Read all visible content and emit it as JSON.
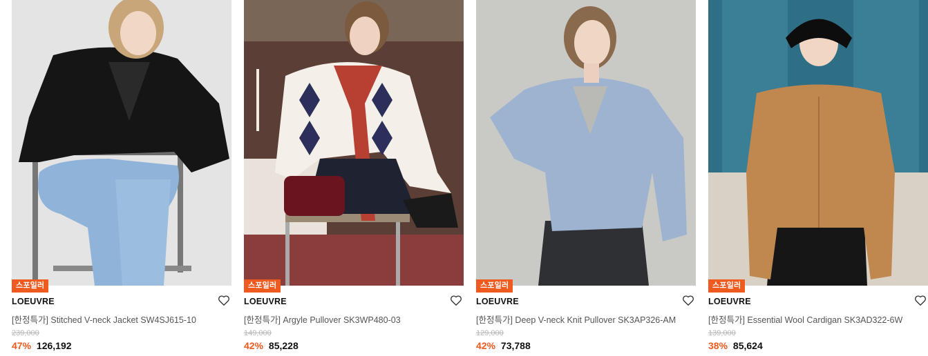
{
  "colors": {
    "accent": "#ef5a1f",
    "price": "#111111",
    "strike": "#b5b5b5"
  },
  "products": [
    {
      "badge": "스포일러",
      "brand": "LOEUVRE",
      "name": "[한정특가] Stitched V-neck Jacket SW4SJ615-10",
      "original_price": "239,000",
      "discount": "47%",
      "price": "126,192",
      "icon": "heart-icon"
    },
    {
      "badge": "스포일러",
      "brand": "LOEUVRE",
      "name": "[한정특가] Argyle Pullover SK3WP480-03",
      "original_price": "149,000",
      "discount": "42%",
      "price": "85,228",
      "icon": "heart-icon"
    },
    {
      "badge": "스포일러",
      "brand": "LOEUVRE",
      "name": "[한정특가] Deep V-neck Knit Pullover SK3AP326-AM",
      "original_price": "129,000",
      "discount": "42%",
      "price": "73,788",
      "icon": "heart-icon"
    },
    {
      "badge": "스포일러",
      "brand": "LOEUVRE",
      "name": "[한정특가] Essential Wool Cardigan SK3AD322-6W",
      "original_price": "139,000",
      "discount": "38%",
      "price": "85,624",
      "icon": "heart-icon"
    }
  ]
}
